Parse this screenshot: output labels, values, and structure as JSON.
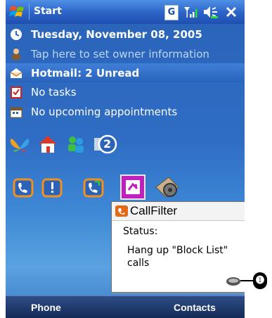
{
  "titlebar": {
    "title": "Start",
    "indicator_label": "G",
    "icons": [
      "windows-flag-icon",
      "gprs-icon",
      "signal-icon",
      "volume-icon",
      "close-icon"
    ]
  },
  "today": {
    "rows": [
      {
        "icon": "clock-icon",
        "text": "Tuesday, November 08, 2005"
      },
      {
        "icon": "owner-icon",
        "text": "Tap here to set owner information"
      },
      {
        "icon": "mail-icon",
        "text": "Hotmail: 2 Unread"
      },
      {
        "icon": "tasks-icon",
        "text": "No tasks"
      },
      {
        "icon": "calendar-icon",
        "text": "No upcoming appointments"
      }
    ],
    "shortcuts": {
      "row1": [
        "msn-butterfly-icon",
        "home-icon",
        "contacts-icon",
        "bubble-2-icon"
      ],
      "row1_badge": "2",
      "row2": [
        "phone-in-icon",
        "phone-alert-icon",
        "phone-out-icon",
        "callfilter-selected-icon",
        "certificate-gear-icon"
      ]
    }
  },
  "popup": {
    "title": "CallFilter",
    "status_label": "Status:",
    "message": "Hang up \"Block List\" calls",
    "tray_icon": "callfilter-tray-icon"
  },
  "softkeys": {
    "left": "Phone",
    "right": "Contacts"
  },
  "callout": {
    "label": "❶"
  },
  "colors": {
    "background": "#2f6dc4",
    "titlebar": "#2c63c6",
    "softbar": "#223d70",
    "accent": "#c21fbf"
  }
}
